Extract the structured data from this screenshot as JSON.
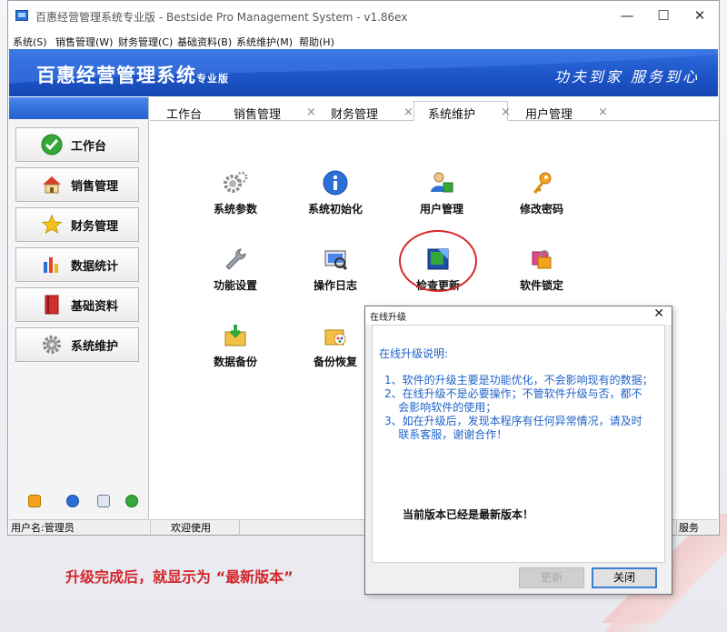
{
  "window": {
    "title": "百惠经营管理系统专业版 - Bestside Pro Management System - v1.86ex",
    "controls": {
      "minimize": "—",
      "maximize": "☐",
      "close": "✕"
    }
  },
  "menu": [
    "系统(S)",
    "销售管理(W)",
    "财务管理(C)",
    "基础资料(B)",
    "系统维护(M)",
    "帮助(H)"
  ],
  "banner": {
    "title": "百惠经营管理系统",
    "edition": "专业版",
    "slogan": "功夫到家  服务到心"
  },
  "sidebar": {
    "buttons": [
      {
        "label": "工作台",
        "icon": "check-circle-icon"
      },
      {
        "label": "销售管理",
        "icon": "house-icon"
      },
      {
        "label": "财务管理",
        "icon": "star-icon"
      },
      {
        "label": "数据统计",
        "icon": "bar-chart-icon"
      },
      {
        "label": "基础资料",
        "icon": "book-icon"
      },
      {
        "label": "系统维护",
        "icon": "gear-icon"
      }
    ],
    "footer_icons": [
      "key-icon",
      "clock-icon",
      "search-icon",
      "exit-icon"
    ]
  },
  "tabs": [
    {
      "label": "工作台"
    },
    {
      "label": "销售管理",
      "close": "×"
    },
    {
      "label": "财务管理",
      "close": "×"
    },
    {
      "label": "系统维护",
      "close": "×",
      "active": true
    },
    {
      "label": "用户管理",
      "close": "×"
    }
  ],
  "functions": [
    {
      "label": "系统参数",
      "icon": "gears-icon"
    },
    {
      "label": "系统初始化",
      "icon": "info-icon"
    },
    {
      "label": "用户管理",
      "icon": "users-icon"
    },
    {
      "label": "修改密码",
      "icon": "key-icon"
    },
    {
      "label": "功能设置",
      "icon": "wrench-icon"
    },
    {
      "label": "操作日志",
      "icon": "log-icon"
    },
    {
      "label": "检查更新",
      "icon": "update-icon"
    },
    {
      "label": "软件锁定",
      "icon": "lock-icon"
    },
    {
      "label": "数据备份",
      "icon": "backup-icon"
    },
    {
      "label": "备份恢复",
      "icon": "restore-icon"
    }
  ],
  "status": {
    "user": "用户名:管理员",
    "welcome": "欢迎使用",
    "service": "服务"
  },
  "dialog": {
    "title": "在线升级",
    "close": "✕",
    "heading": "在线升级说明:",
    "lines": [
      "1、软件的升级主要是功能优化，不会影响现有的数据；",
      "2、在线升级不是必要操作；不管软件升级与否，都不",
      "    会影响软件的使用；",
      "3、如在升级后，发现本程序有任何异常情况，请及时",
      "    联系客服，谢谢合作！"
    ],
    "result": "当前版本已经是最新版本！",
    "update_button": "更新",
    "close_button": "关闭"
  },
  "caption": "升级完成后，就显示为 “最新版本”",
  "colors": {
    "banner": "#1d55c8",
    "dialog_text": "#1e62c9",
    "caption": "#d2262b",
    "highlight": "#d8262a"
  }
}
